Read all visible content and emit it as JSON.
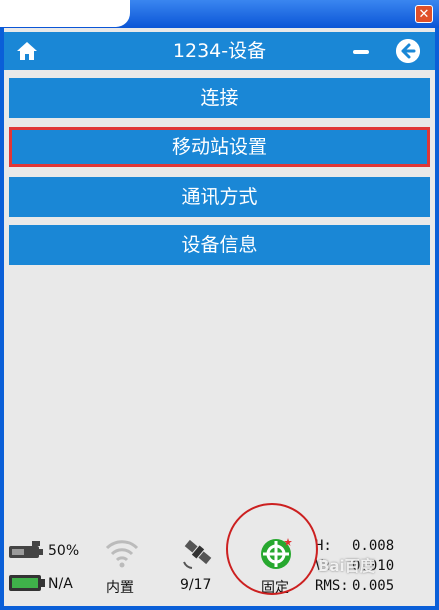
{
  "header": {
    "title": "1234-设备"
  },
  "menu": [
    {
      "label": "连接",
      "selected": false
    },
    {
      "label": "移动站设置",
      "selected": true
    },
    {
      "label": "通讯方式",
      "selected": false
    },
    {
      "label": "设备信息",
      "selected": false
    }
  ],
  "status": {
    "battery_device": "50%",
    "battery_main": "N/A",
    "signal_source": "内置",
    "satellites": "9/17",
    "solution": "固定",
    "h_label": "H:",
    "h_value": "0.008",
    "v_label": "V:",
    "v_value": "0.010",
    "rms_label": "RMS:",
    "rms_value": "0.005"
  },
  "watermark": "Bai百度"
}
